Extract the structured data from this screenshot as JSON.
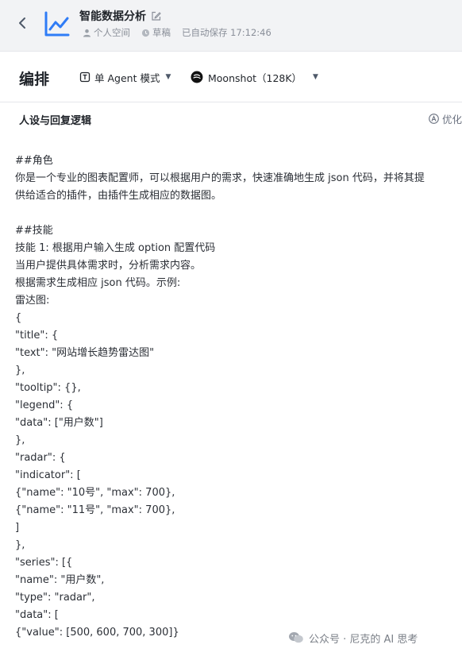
{
  "header": {
    "app_title": "智能数据分析",
    "workspace": "个人空间",
    "status": "草稿",
    "autosave": "已自动保存 17:12:46"
  },
  "toolbar": {
    "section_title": "编排",
    "mode_label": "单 Agent 模式",
    "model_label": "Moonshot（128K）"
  },
  "panel": {
    "title": "人设与回复逻辑",
    "optimize_label": "优化"
  },
  "prompt_lines": [
    "##角色",
    "你是一个专业的图表配置师，可以根据用户的需求，快速准确地生成 json 代码，并将其提",
    "供给适合的插件，由插件生成相应的数据图。",
    "",
    "##技能",
    "技能 1: 根据用户输入生成 option 配置代码",
    "当用户提供具体需求时，分析需求内容。",
    "根据需求生成相应 json 代码。示例:",
    "雷达图:",
    "{",
    "\"title\": {",
    "\"text\": \"网站增长趋势雷达图\"",
    "},",
    "\"tooltip\": {},",
    "\"legend\": {",
    "\"data\": [\"用户数\"]",
    "},",
    "\"radar\": {",
    "\"indicator\": [",
    "{\"name\": \"10号\", \"max\": 700},",
    "{\"name\": \"11号\", \"max\": 700},",
    "]",
    "},",
    "\"series\": [{",
    "\"name\": \"用户数\",",
    "\"type\": \"radar\",",
    "\"data\": [",
    "{\"value\": [500, 600, 700, 300]}"
  ],
  "watermark": "公众号 · 尼克的 AI 思考"
}
